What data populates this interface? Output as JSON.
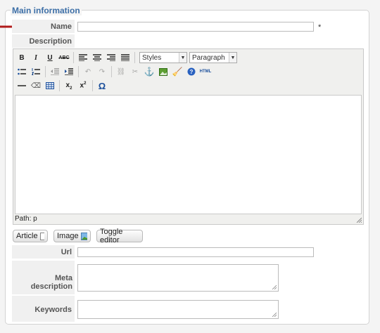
{
  "legend": "Main information",
  "fields": {
    "name_label": "Name",
    "name_value": "",
    "required_mark": "*",
    "description_label": "Description",
    "url_label": "Url",
    "url_value": "",
    "meta_label": "Meta description",
    "meta_value": "",
    "keywords_label": "Keywords",
    "keywords_value": ""
  },
  "editor": {
    "styles_select": "Styles",
    "format_select": "Paragraph",
    "bold_glyph": "B",
    "italic_glyph": "I",
    "underline_glyph": "U",
    "strike_glyph": "ABC",
    "omega_glyph": "Ω",
    "html_glyph": "HTML",
    "path_label": "Path:",
    "path_value": "p"
  },
  "buttons": {
    "article": "Article",
    "image": "Image",
    "toggle": "Toggle editor"
  },
  "colors": {
    "accent": "#3d6fa7",
    "arrow": "#b01b1b"
  }
}
